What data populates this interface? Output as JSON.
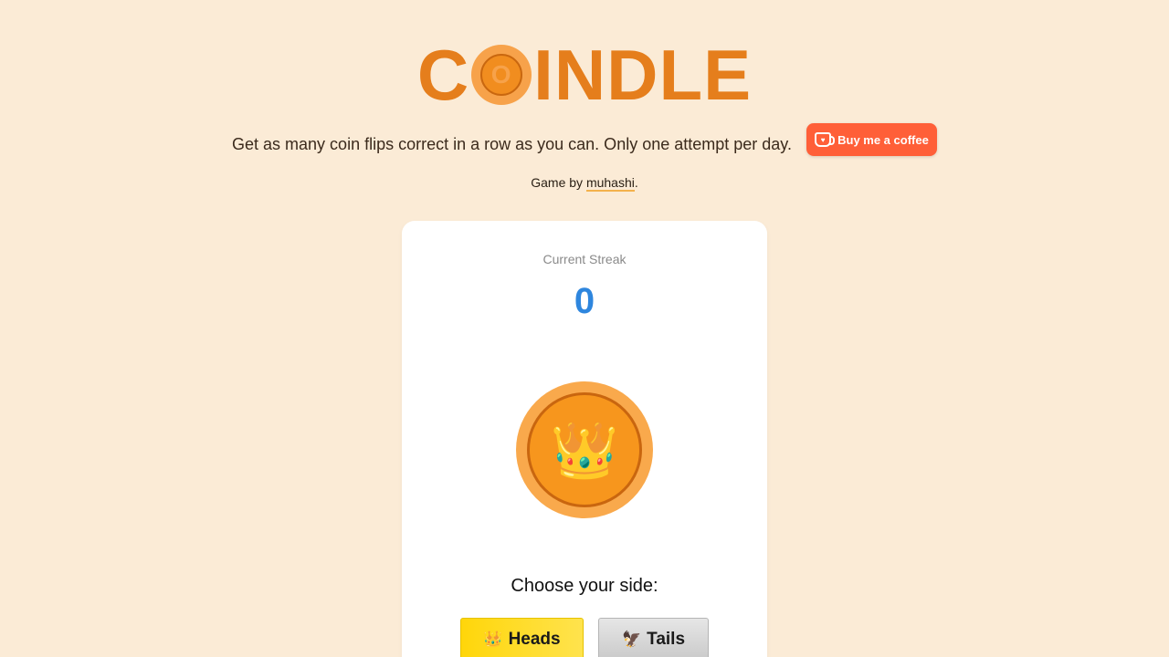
{
  "header": {
    "logo_prefix": "C",
    "logo_coin_letter": "O",
    "logo_suffix": "INDLE",
    "tagline": "Get as many coin flips correct in a row as you can. Only one attempt per day.",
    "coffee_button_label": "Buy me a coffee",
    "byline_prefix": "Game by ",
    "byline_author": "muhashi",
    "byline_suffix": "."
  },
  "game": {
    "streak_label": "Current Streak",
    "streak_value": "0",
    "coin_face_icon": "👑",
    "choose_prompt": "Choose your side:",
    "heads_icon": "👑",
    "heads_label": "Heads",
    "tails_icon": "🦅",
    "tails_label": "Tails"
  },
  "colors": {
    "background": "#fbebd6",
    "brand_orange": "#e57e1c",
    "streak_blue": "#2e86de",
    "coffee_button": "#ff5f38",
    "heads_yellow": "#ffd60a",
    "tails_gray": "#d6d6d6"
  },
  "icons": {
    "logo_coin": "coin-icon",
    "coffee": "coffee-cup-icon",
    "coin_face": "crown-icon",
    "heads": "crown-icon",
    "tails": "eagle-icon"
  }
}
